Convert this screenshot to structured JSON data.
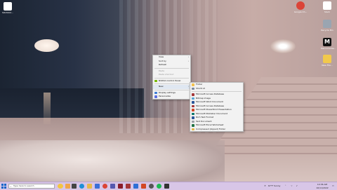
{
  "desktop_icons": [
    {
      "label": "SOLTAK2..."
    },
    {
      "label": "Google Ch...",
      "color": "#db4437"
    },
    {
      "label": "Slack",
      "color": "#4a154b"
    },
    {
      "label": "Recycle Bin",
      "color": "#9aa5b1"
    },
    {
      "label": "Macromedia...",
      "color": "#111111"
    },
    {
      "label": "New File...",
      "color": "#f2c94c"
    }
  ],
  "context_menu": {
    "items": [
      {
        "label": "View",
        "arrow": "›"
      },
      {
        "label": "Sort by",
        "arrow": "›"
      },
      {
        "label": "Refresh"
      },
      {
        "label": "Paste"
      },
      {
        "label": "Paste shortcut"
      },
      {
        "label": "NVIDIA Control Panel",
        "icon_color": "#76b900"
      },
      {
        "label": "New",
        "arrow": "›"
      },
      {
        "label": "Display settings",
        "icon_color": "#3a7bd5"
      },
      {
        "label": "Personalize",
        "icon_color": "#5b6ee1"
      }
    ]
  },
  "new_submenu": {
    "items": [
      {
        "label": "Folder",
        "icon_color": "#f2c14e"
      },
      {
        "label": "Shortcut",
        "icon_color": "#7a8aa0"
      },
      {
        "label": "Microsoft Access Database",
        "icon_color": "#a4373a"
      },
      {
        "label": "Bitmap image",
        "icon_color": "#58a6d6"
      },
      {
        "label": "Microsoft Word Document",
        "icon_color": "#2b579a"
      },
      {
        "label": "Microsoft Access Database",
        "icon_color": "#a4373a"
      },
      {
        "label": "Microsoft PowerPoint Presentation",
        "icon_color": "#d24726"
      },
      {
        "label": "Microsoft Publisher Document",
        "icon_color": "#077568"
      },
      {
        "label": "Rich Text Format",
        "icon_color": "#2b579a"
      },
      {
        "label": "Text Document",
        "icon_color": "#9aa0a6"
      },
      {
        "label": "Microsoft Excel Worksheet",
        "icon_color": "#217346"
      },
      {
        "label": "Compressed (zipped) Folder",
        "icon_color": "#e5b94a"
      }
    ]
  },
  "taskbar": {
    "search_placeholder": "Type here to search",
    "weather": "67°F Sunny",
    "time": "10:36 AM",
    "date": "10/11/2022",
    "apps": [
      {
        "name": "task-view-icon",
        "color": "#444444"
      },
      {
        "name": "edge-icon",
        "color": "#1f8fd6"
      },
      {
        "name": "file-explorer-icon",
        "color": "#e9b949"
      },
      {
        "name": "store-icon",
        "color": "#3a6fd8"
      },
      {
        "name": "chrome-icon",
        "color": "#db4437"
      },
      {
        "name": "teams-icon",
        "color": "#5558af"
      },
      {
        "name": "app-icon",
        "color": "#8a1c2a"
      },
      {
        "name": "access-icon",
        "color": "#a4373a"
      },
      {
        "name": "mail-icon",
        "color": "#2f6fd6"
      },
      {
        "name": "powerpoint-icon",
        "color": "#d24726"
      },
      {
        "name": "settings-icon",
        "color": "#555555"
      },
      {
        "name": "spotify-icon",
        "color": "#1db954"
      },
      {
        "name": "app2-icon",
        "color": "#333333"
      }
    ]
  }
}
